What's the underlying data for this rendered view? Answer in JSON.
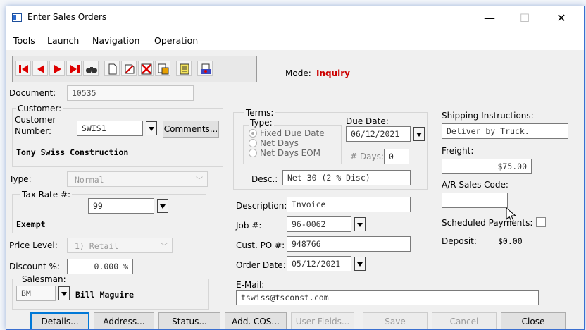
{
  "window": {
    "title": "Enter Sales Orders",
    "controls": {
      "minimize": "—",
      "maximize": "☐",
      "close": "✕"
    }
  },
  "menu": [
    "Tools",
    "Launch",
    "Navigation",
    "Operation"
  ],
  "toolbar": {
    "icons": [
      "first-record-icon",
      "previous-record-icon",
      "next-record-icon",
      "last-record-icon",
      "find-icon",
      "new-document-icon",
      "edit-icon",
      "delete-icon",
      "print-icon",
      "notes-icon",
      "post-icon"
    ]
  },
  "mode": {
    "label": "Mode:",
    "value": "Inquiry",
    "color": "#cc0000"
  },
  "document": {
    "label": "Document:",
    "value": "10535"
  },
  "customer": {
    "group_label": "Customer:",
    "number_label_1": "Customer",
    "number_label_2": "Number:",
    "number": "SWIS1",
    "comments_button": "Comments...",
    "name": "Tony Swiss Construction"
  },
  "type": {
    "label": "Type:",
    "value": "Normal"
  },
  "tax": {
    "label": "Tax Rate #:",
    "value": "99",
    "exempt": "Exempt"
  },
  "price_level": {
    "label": "Price Level:",
    "value": "1) Retail"
  },
  "discount": {
    "label": "Discount %:",
    "value": "0.000 %"
  },
  "salesman": {
    "label": "Salesman:",
    "code": "BM",
    "name": "Bill Maguire"
  },
  "terms": {
    "group_label": "Terms:",
    "type_label": "Type:",
    "options": [
      "Fixed Due Date",
      "Net Days",
      "Net Days EOM"
    ],
    "selected": 0,
    "due_date_label": "Due Date:",
    "due_date": "06/12/2021",
    "days_label": "# Days:",
    "days": "0",
    "desc_label": "Desc.:",
    "desc": "Net 30 (2 % Disc)"
  },
  "description": {
    "label": "Description:",
    "value": "Invoice"
  },
  "job": {
    "label": "Job #:",
    "value": "96-0062"
  },
  "cust_po": {
    "label": "Cust. PO #:",
    "value": "948766"
  },
  "order_date": {
    "label": "Order Date:",
    "value": "05/12/2021"
  },
  "email": {
    "label": "E-Mail:",
    "value": "tswiss@tsconst.com"
  },
  "shipping": {
    "label": "Shipping Instructions:",
    "value": "Deliver by Truck."
  },
  "freight": {
    "label": "Freight:",
    "value": "$75.00"
  },
  "ar_sales_code": {
    "label": "A/R Sales Code:",
    "value": ""
  },
  "scheduled_payments": {
    "label": "Scheduled Payments:"
  },
  "deposit": {
    "label": "Deposit:",
    "value": "$0.00"
  },
  "buttons": {
    "details": "Details...",
    "address": "Address...",
    "status": "Status...",
    "add_cos": "Add. COS...",
    "user_fields": "User Fields...",
    "save": "Save",
    "cancel": "Cancel",
    "close": "Close"
  }
}
